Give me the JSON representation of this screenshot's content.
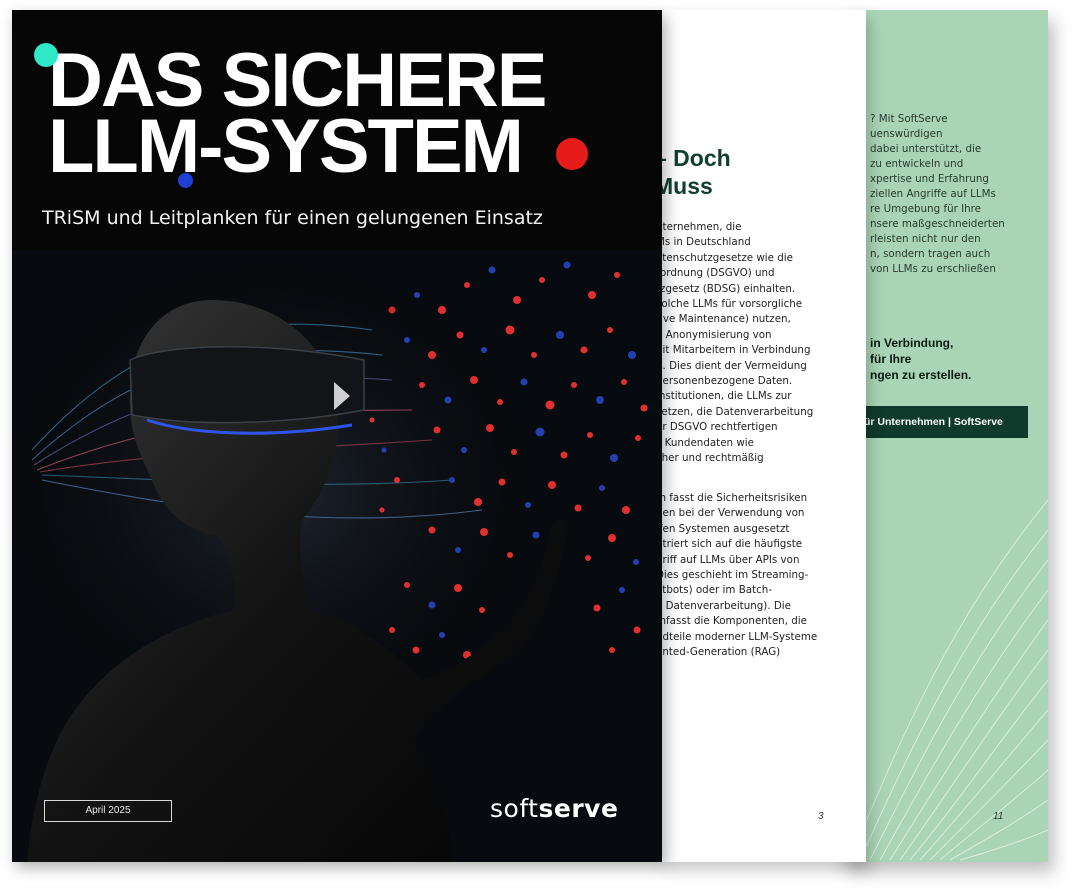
{
  "cover": {
    "title_line1": "DAS SICHERE",
    "title_line2": "LLM-SYSTEM",
    "subtitle": "TRiSM und Leitplanken für einen gelungenen Einsatz",
    "date": "April 2025",
    "logo_light": "soft",
    "logo_bold": "serve",
    "accent_colors": {
      "teal": "#2ee8c8",
      "red": "#e81b1b",
      "blue": "#1f3fd6"
    }
  },
  "inner_page": {
    "heading_line1": "– Doch",
    "heading_line2": "Muss",
    "paragraph1": [
      "nternehmen, die",
      "Ms in Deutschland",
      "atenschutzgesetze wie die",
      "rordnung (DSGVO) und",
      "tzgesetz (BDSG) einhalten.",
      "solche LLMs für vorsorgliche",
      "tive Maintenance) nutzen,",
      "e Anonymisierung von",
      "nit Mitarbeitern in Verbindung",
      "n. Dies dient der Vermeidung",
      "personenbezogene Daten.",
      "institutionen, die LLMs zur",
      "setzen, die Datenverarbeitung",
      "er DSGVO rechtfertigen",
      "s Kundendaten wie",
      "cher und rechtmäßig"
    ],
    "paragraph2": [
      "m fasst die Sicherheitsrisiken",
      "nen bei der Verwendung von",
      "ifen Systemen ausgesetzt",
      "ntriert sich auf die häufigste",
      "griff auf LLMs über APIs von",
      "Dies geschieht im Streaming-",
      "atbots) oder im Batch-",
      "e Datenverarbeitung). Die",
      "mfasst die Komponenten, die",
      "ndteile moderner LLM-Systeme",
      "ented-Generation (RAG)"
    ],
    "page_number": "3"
  },
  "back_page": {
    "paragraph": [
      "? Mit SoftServe",
      "uenswürdigen",
      "dabei unterstützt, die",
      "zu entwickeln und",
      "xpertise und Erfahrung",
      "ziellen Angriffe auf LLMs",
      "re Umgebung für Ihre",
      "nsere maßgeschneiderten",
      "rleisten nicht nur den",
      "n, sondern tragen auch",
      "von LLMs zu erschließen"
    ],
    "bold_lines": [
      "in Verbindung,",
      "für Ihre",
      "ngen zu erstellen."
    ],
    "cta_label": "ür Unternehmen | SoftServe",
    "page_number": "11"
  }
}
